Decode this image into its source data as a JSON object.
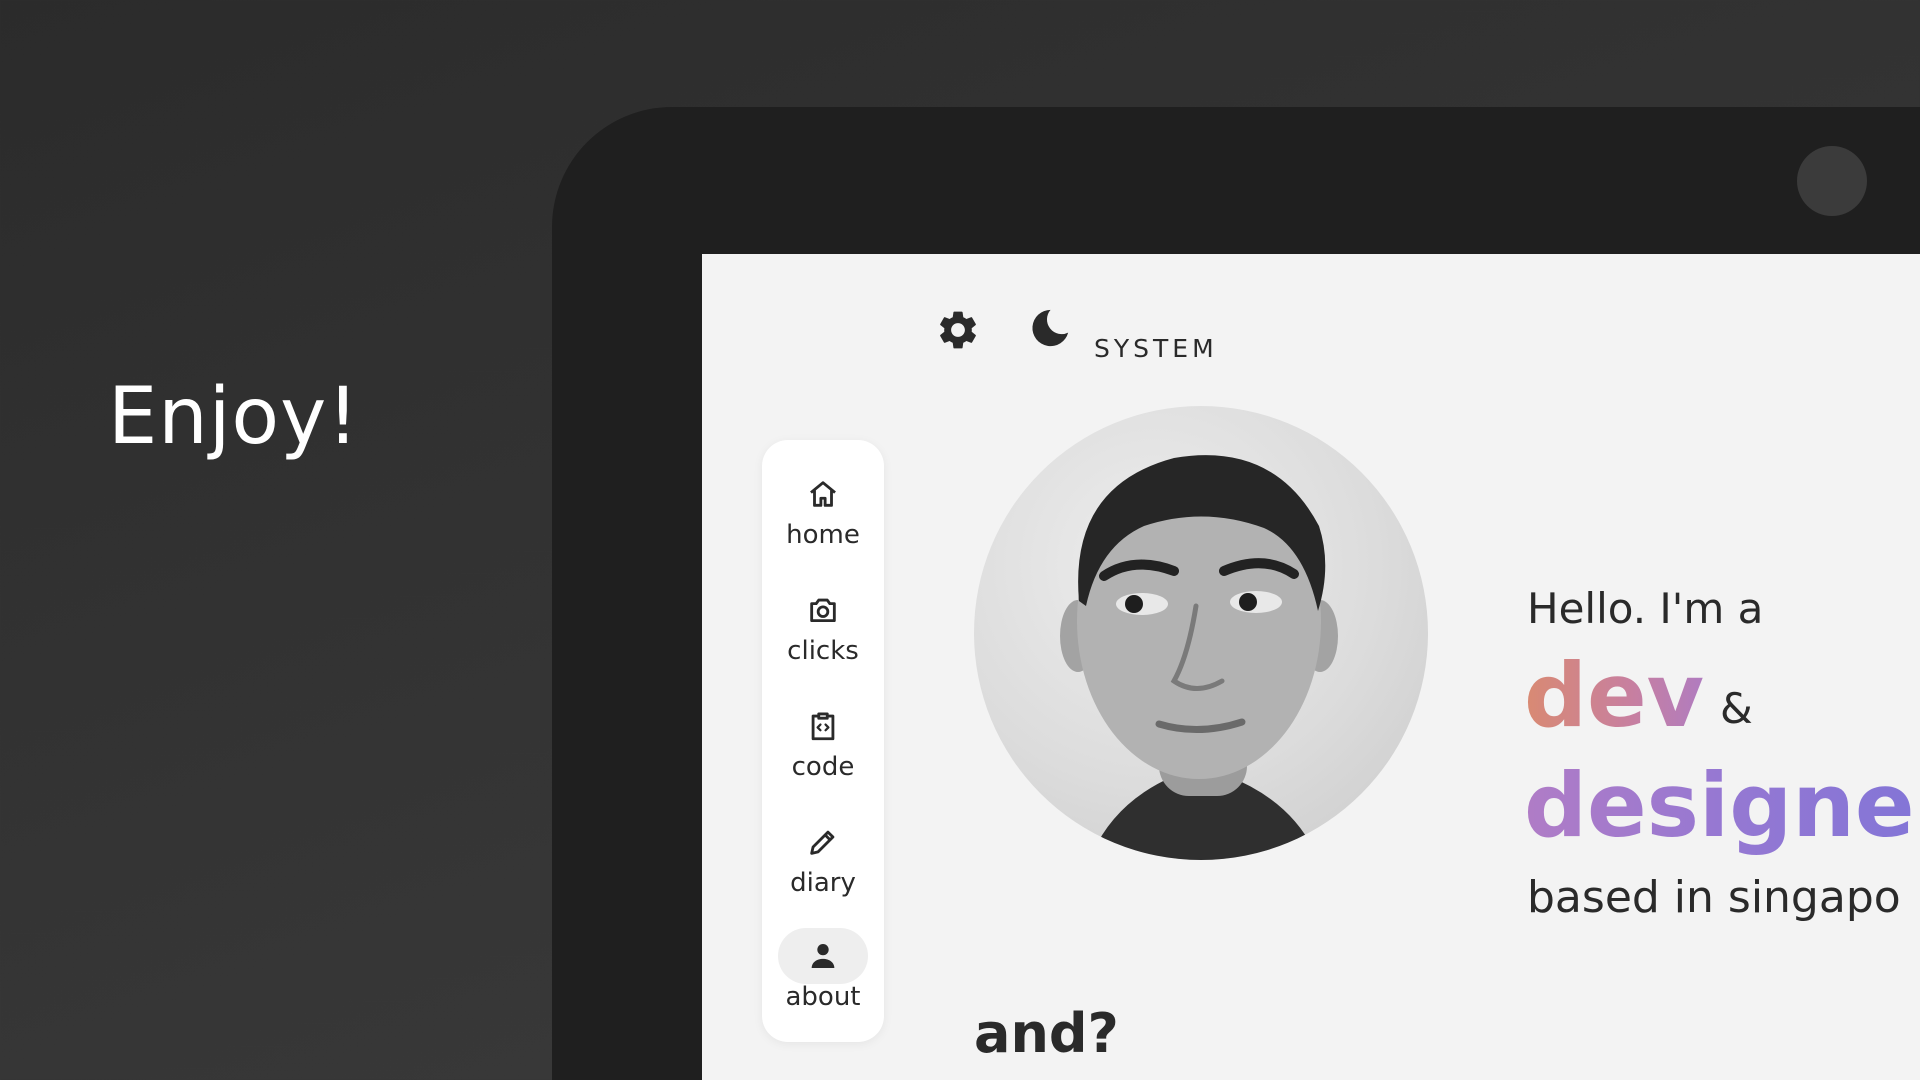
{
  "headline": "Enjoy!",
  "top_controls": {
    "settings_icon": "gear-icon",
    "theme_icon": "moon-icon",
    "theme_label": "SYSTEM"
  },
  "nav": {
    "items": [
      {
        "label": "home",
        "icon": "home-icon",
        "active": false
      },
      {
        "label": "clicks",
        "icon": "camera-icon",
        "active": false
      },
      {
        "label": "code",
        "icon": "clipboard-code-icon",
        "active": false
      },
      {
        "label": "diary",
        "icon": "pencil-icon",
        "active": false
      },
      {
        "label": "about",
        "icon": "person-icon",
        "active": true
      }
    ]
  },
  "intro": {
    "greeting": "Hello. I'm a",
    "role_1": "dev",
    "connector": "&",
    "role_2": "designer",
    "location_line": "based in singapo"
  },
  "section_heading": "and?",
  "colors": {
    "background": "#333333",
    "device": "#1f1f1f",
    "screen": "#f3f3f3",
    "dev_gradient": [
      "#d98a72",
      "#b07cc0"
    ],
    "designer_gradient": [
      "#b07cc6",
      "#7f74d8"
    ],
    "text": "#2a2a2a"
  }
}
